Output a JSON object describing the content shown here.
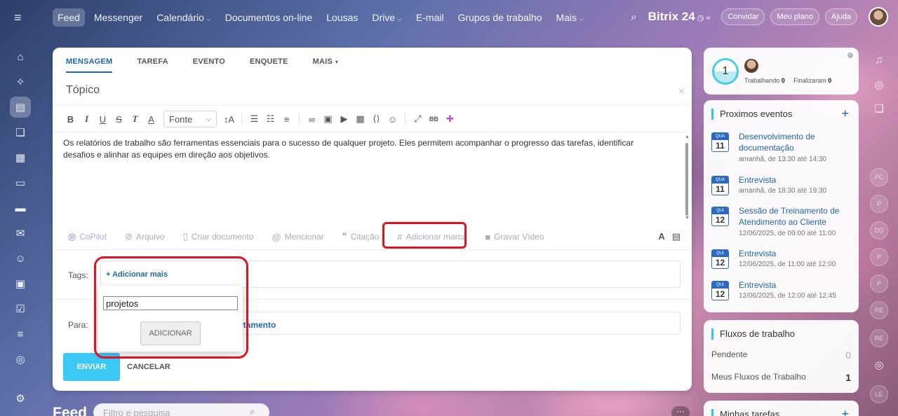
{
  "topnav": {
    "items": [
      {
        "label": "Feed",
        "active": true,
        "chevron": false
      },
      {
        "label": "Messenger",
        "active": false,
        "chevron": false
      },
      {
        "label": "Calendário",
        "active": false,
        "chevron": true
      },
      {
        "label": "Documentos on-line",
        "active": false,
        "chevron": false
      },
      {
        "label": "Lousas",
        "active": false,
        "chevron": false
      },
      {
        "label": "Drive",
        "active": false,
        "chevron": true
      },
      {
        "label": "E-mail",
        "active": false,
        "chevron": false
      },
      {
        "label": "Grupos de trabalho",
        "active": false,
        "chevron": false
      },
      {
        "label": "Mais",
        "active": false,
        "chevron": true
      }
    ],
    "brand": "Bitrix 24",
    "invite_label": "Convidar",
    "plan_label": "Meu plano",
    "help_label": "Ajuda"
  },
  "composer": {
    "tabs": [
      {
        "label": "MENSAGEM",
        "active": true
      },
      {
        "label": "TAREFA",
        "active": false
      },
      {
        "label": "EVENTO",
        "active": false
      },
      {
        "label": "ENQUETE",
        "active": false
      },
      {
        "label": "MAIS",
        "active": false
      }
    ],
    "topic_placeholder": "Tópico",
    "font_label": "Fonte",
    "body": "Os relatórios de trabalho são ferramentas essenciais para o sucesso de qualquer projeto. Eles permitem acompanhar o progresso das tarefas, identificar desafios e alinhar as equipes em direção aos objetivos.",
    "actions": {
      "copilot": "CoPilot",
      "file": "Arquivo",
      "create_doc": "Criar documento",
      "mention": "Mencionar",
      "quote": "Citação",
      "add_tag": "Adicionar marca",
      "record_video": "Gravar Vídeo"
    },
    "tags_label": "Tags:",
    "add_more_label": "+ Adicionar mais",
    "to_label": "Para:",
    "to_value_partial": "rtamento",
    "send_label": "ENVIAR",
    "cancel_label": "CANCELAR"
  },
  "tag_popup": {
    "input_value": "projetos",
    "button_label": "ADICIONAR"
  },
  "feed": {
    "title": "Feed",
    "filter_placeholder": "Filtro e pesquisa"
  },
  "status_widget": {
    "count": "1",
    "working_label": "Trabalhando",
    "working_count": "0",
    "finished_label": "Finalizaram",
    "finished_count": "0"
  },
  "events_widget": {
    "title": "Proximos eventos",
    "events": [
      {
        "weekday": "QUA",
        "day": "11",
        "title": "Desenvolvimento de documentação",
        "time": "amanhã, de 13:30 até 14:30"
      },
      {
        "weekday": "QUA",
        "day": "11",
        "title": "Entrevista",
        "time": "amanhã, de 18:30 até 19:30"
      },
      {
        "weekday": "QUI",
        "day": "12",
        "title": "Sessão de Treinamento de Atendimento ao Cliente",
        "time": "12/06/2025, de 09:00 até 11:00"
      },
      {
        "weekday": "QUI",
        "day": "12",
        "title": "Entrevista",
        "time": "12/06/2025, de 11:00 até 12:00"
      },
      {
        "weekday": "QUI",
        "day": "12",
        "title": "Entrevista",
        "time": "12/06/2025, de 12:00 até 12:45"
      }
    ]
  },
  "flows_widget": {
    "title": "Fluxos de trabalho",
    "pending_label": "Pendente",
    "pending_count": "0",
    "mine_label": "Meus Fluxos de Trabalho",
    "mine_count": "1"
  },
  "tasks_widget": {
    "title": "Minhas tarefas"
  },
  "rail": {
    "bubbles": [
      "PC",
      "P",
      "DD",
      "P",
      "P",
      "RE",
      "RE",
      "LE"
    ]
  },
  "colors": {
    "accent": "#2066b0",
    "send": "#3bc8f5",
    "highlight": "#e3121e"
  }
}
